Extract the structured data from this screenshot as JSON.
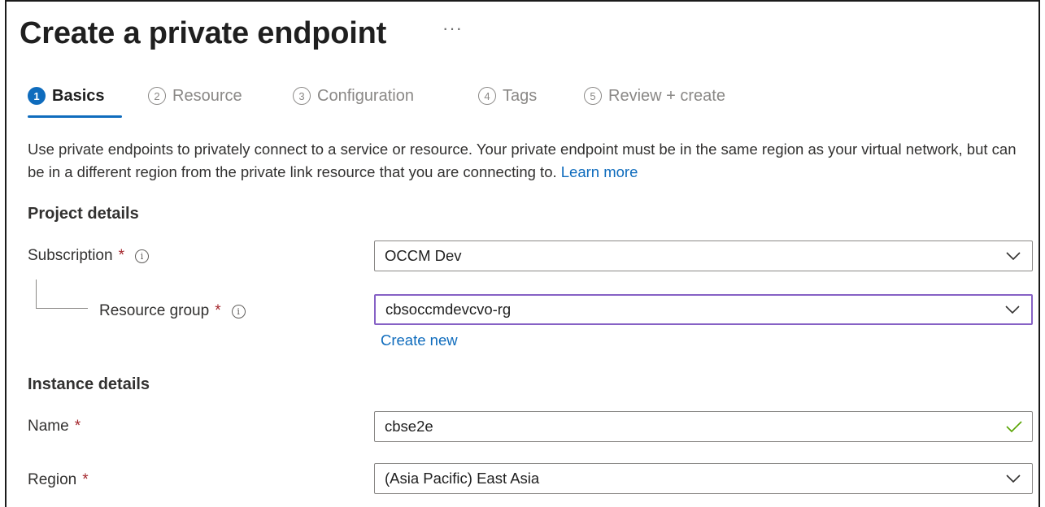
{
  "page": {
    "title": "Create a private endpoint",
    "more_label": "···"
  },
  "tabs": [
    {
      "num": "1",
      "label": "Basics",
      "active": true
    },
    {
      "num": "2",
      "label": "Resource",
      "active": false
    },
    {
      "num": "3",
      "label": "Configuration",
      "active": false
    },
    {
      "num": "4",
      "label": "Tags",
      "active": false
    },
    {
      "num": "5",
      "label": "Review + create",
      "active": false
    }
  ],
  "description": {
    "text": "Use private endpoints to privately connect to a service or resource. Your private endpoint must be in the same region as your virtual network, but can be in a different region from the private link resource that you are connecting to. ",
    "link": "Learn more"
  },
  "project_details": {
    "heading": "Project details",
    "subscription": {
      "label": "Subscription",
      "required": "*",
      "value": "OCCM Dev"
    },
    "resource_group": {
      "label": "Resource group",
      "required": "*",
      "value": "cbsoccmdevcvo-rg",
      "create_new": "Create new"
    }
  },
  "instance_details": {
    "heading": "Instance details",
    "name": {
      "label": "Name",
      "required": "*",
      "value": "cbse2e"
    },
    "region": {
      "label": "Region",
      "required": "*",
      "value": "(Asia Pacific) East Asia"
    }
  },
  "icons": {
    "info": "i"
  },
  "colors": {
    "accent": "#0f6cbd",
    "required": "#a4262c",
    "focus": "#8661c5",
    "valid": "#57a300"
  }
}
